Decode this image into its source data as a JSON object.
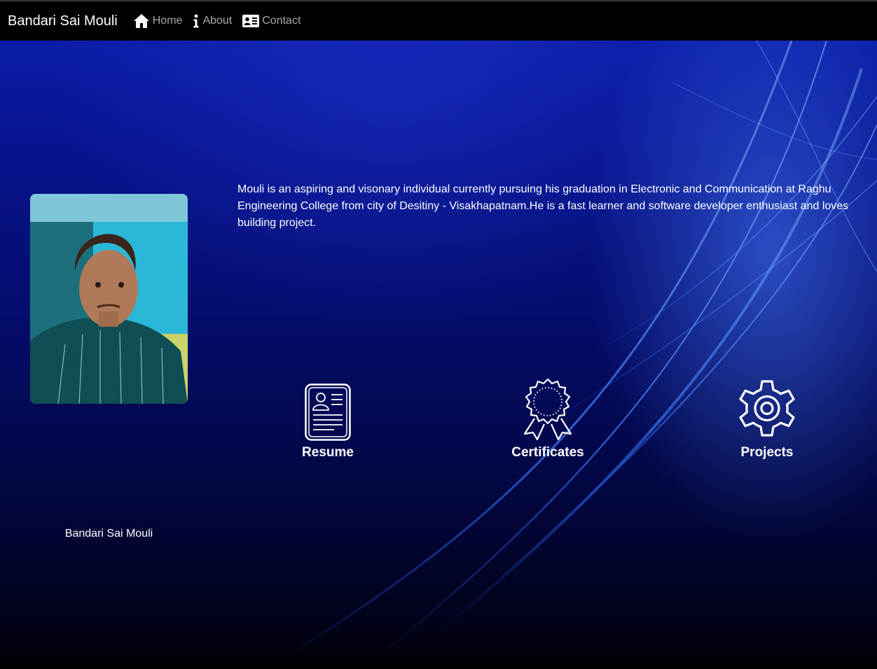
{
  "navbar": {
    "brand": "Bandari Sai Mouli",
    "links": [
      {
        "label": "Home",
        "icon": "home-icon"
      },
      {
        "label": "About",
        "icon": "info-icon"
      },
      {
        "label": "Contact",
        "icon": "contact-card-icon"
      }
    ]
  },
  "profile": {
    "photo_alt": "profile-photo",
    "bio": "Mouli is an aspiring and visonary individual currently pursuing his graduation in Electronic and Communication at Raghu Engineering College from city of Desitiny - Visakhapatnam.He is a fast learner and software developer enthusiast and loves building project.",
    "name": "Bandari Sai Mouli"
  },
  "cards": [
    {
      "label": "Resume",
      "icon": "resume-icon"
    },
    {
      "label": "Certificates",
      "icon": "certificate-badge-icon"
    },
    {
      "label": "Projects",
      "icon": "gear-icon"
    }
  ],
  "colors": {
    "navbar_bg": "#000000",
    "nav_link": "#a9a9a9",
    "hero_top": "#0a1da8",
    "hero_bottom": "#000000",
    "text": "#ffffff"
  }
}
